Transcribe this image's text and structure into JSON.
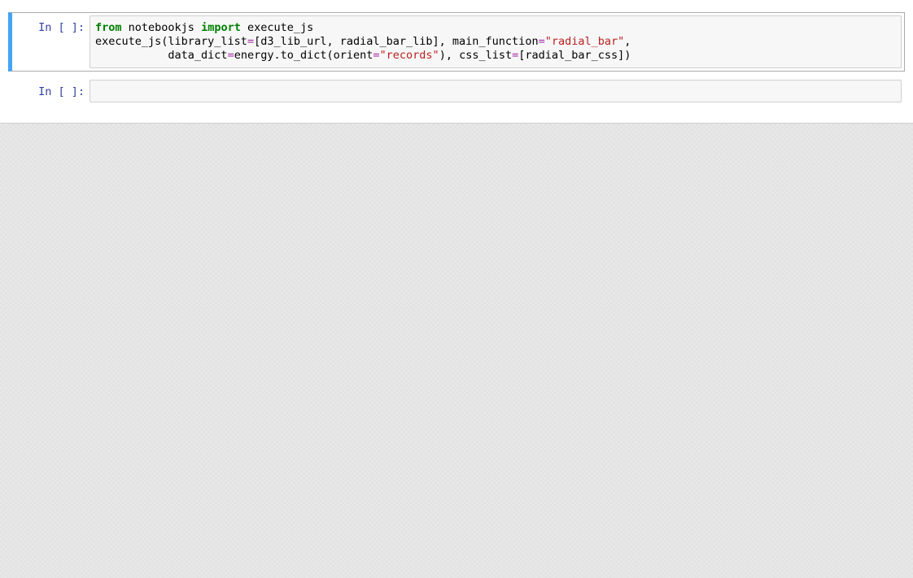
{
  "cells": [
    {
      "prompt": "In [ ]:",
      "selected": true,
      "tokens": [
        {
          "t": "from",
          "cls": "tok-kw"
        },
        {
          "t": " notebookjs ",
          "cls": ""
        },
        {
          "t": "import",
          "cls": "tok-kw"
        },
        {
          "t": " execute_js",
          "cls": ""
        },
        {
          "t": "\n",
          "cls": ""
        },
        {
          "t": "execute_js(library_list",
          "cls": ""
        },
        {
          "t": "=",
          "cls": "tok-op"
        },
        {
          "t": "[d3_lib_url, radial_bar_lib], main_function",
          "cls": ""
        },
        {
          "t": "=",
          "cls": "tok-op"
        },
        {
          "t": "\"radial_bar\"",
          "cls": "tok-str"
        },
        {
          "t": ",",
          "cls": ""
        },
        {
          "t": "\n",
          "cls": ""
        },
        {
          "t": "           data_dict",
          "cls": ""
        },
        {
          "t": "=",
          "cls": "tok-op"
        },
        {
          "t": "energy.to_dict(orient",
          "cls": ""
        },
        {
          "t": "=",
          "cls": "tok-op"
        },
        {
          "t": "\"records\"",
          "cls": "tok-str"
        },
        {
          "t": "), css_list",
          "cls": ""
        },
        {
          "t": "=",
          "cls": "tok-op"
        },
        {
          "t": "[radial_bar_css])",
          "cls": ""
        }
      ]
    },
    {
      "prompt": "In [ ]:",
      "selected": false,
      "tokens": []
    }
  ]
}
